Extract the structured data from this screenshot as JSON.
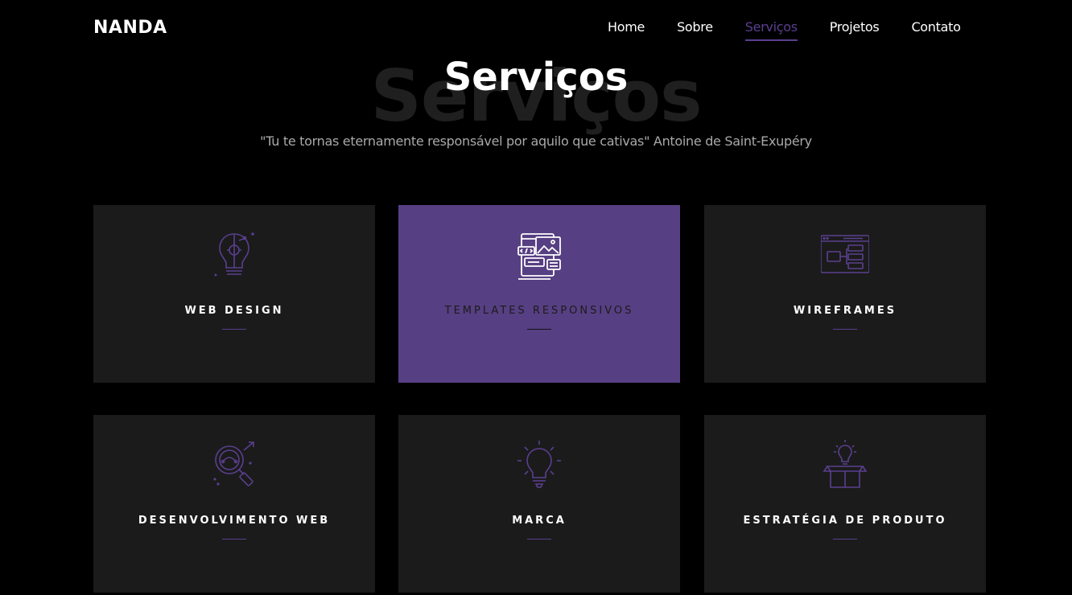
{
  "header": {
    "logo": "NANDA",
    "nav": [
      {
        "label": "Home"
      },
      {
        "label": "Sobre"
      },
      {
        "label": "Serviços"
      },
      {
        "label": "Projetos"
      },
      {
        "label": "Contato"
      }
    ],
    "active_nav": "Serviços"
  },
  "hero": {
    "background_title": "Serviços",
    "title": "Serviços",
    "quote": "\"Tu te tornas eternamente responsável por aquilo que cativas\" Antoine de Saint-Exupéry"
  },
  "services": [
    {
      "title": "WEB DESIGN",
      "icon": "lightbulb-gear-icon"
    },
    {
      "title": "TEMPLATES RESPONSIVOS",
      "icon": "responsive-templates-icon"
    },
    {
      "title": "WIREFRAMES",
      "icon": "wireframe-icon"
    },
    {
      "title": "DESENVOLVIMENTO WEB",
      "icon": "magnifier-analytics-icon"
    },
    {
      "title": "MARCA",
      "icon": "lightbulb-icon"
    },
    {
      "title": "ESTRATÉGIA DE PRODUTO",
      "icon": "box-idea-icon"
    }
  ],
  "colors": {
    "background": "#000000",
    "card": "#1b1b1b",
    "accent": "#573f83",
    "muted_text": "#a9a9a9"
  }
}
